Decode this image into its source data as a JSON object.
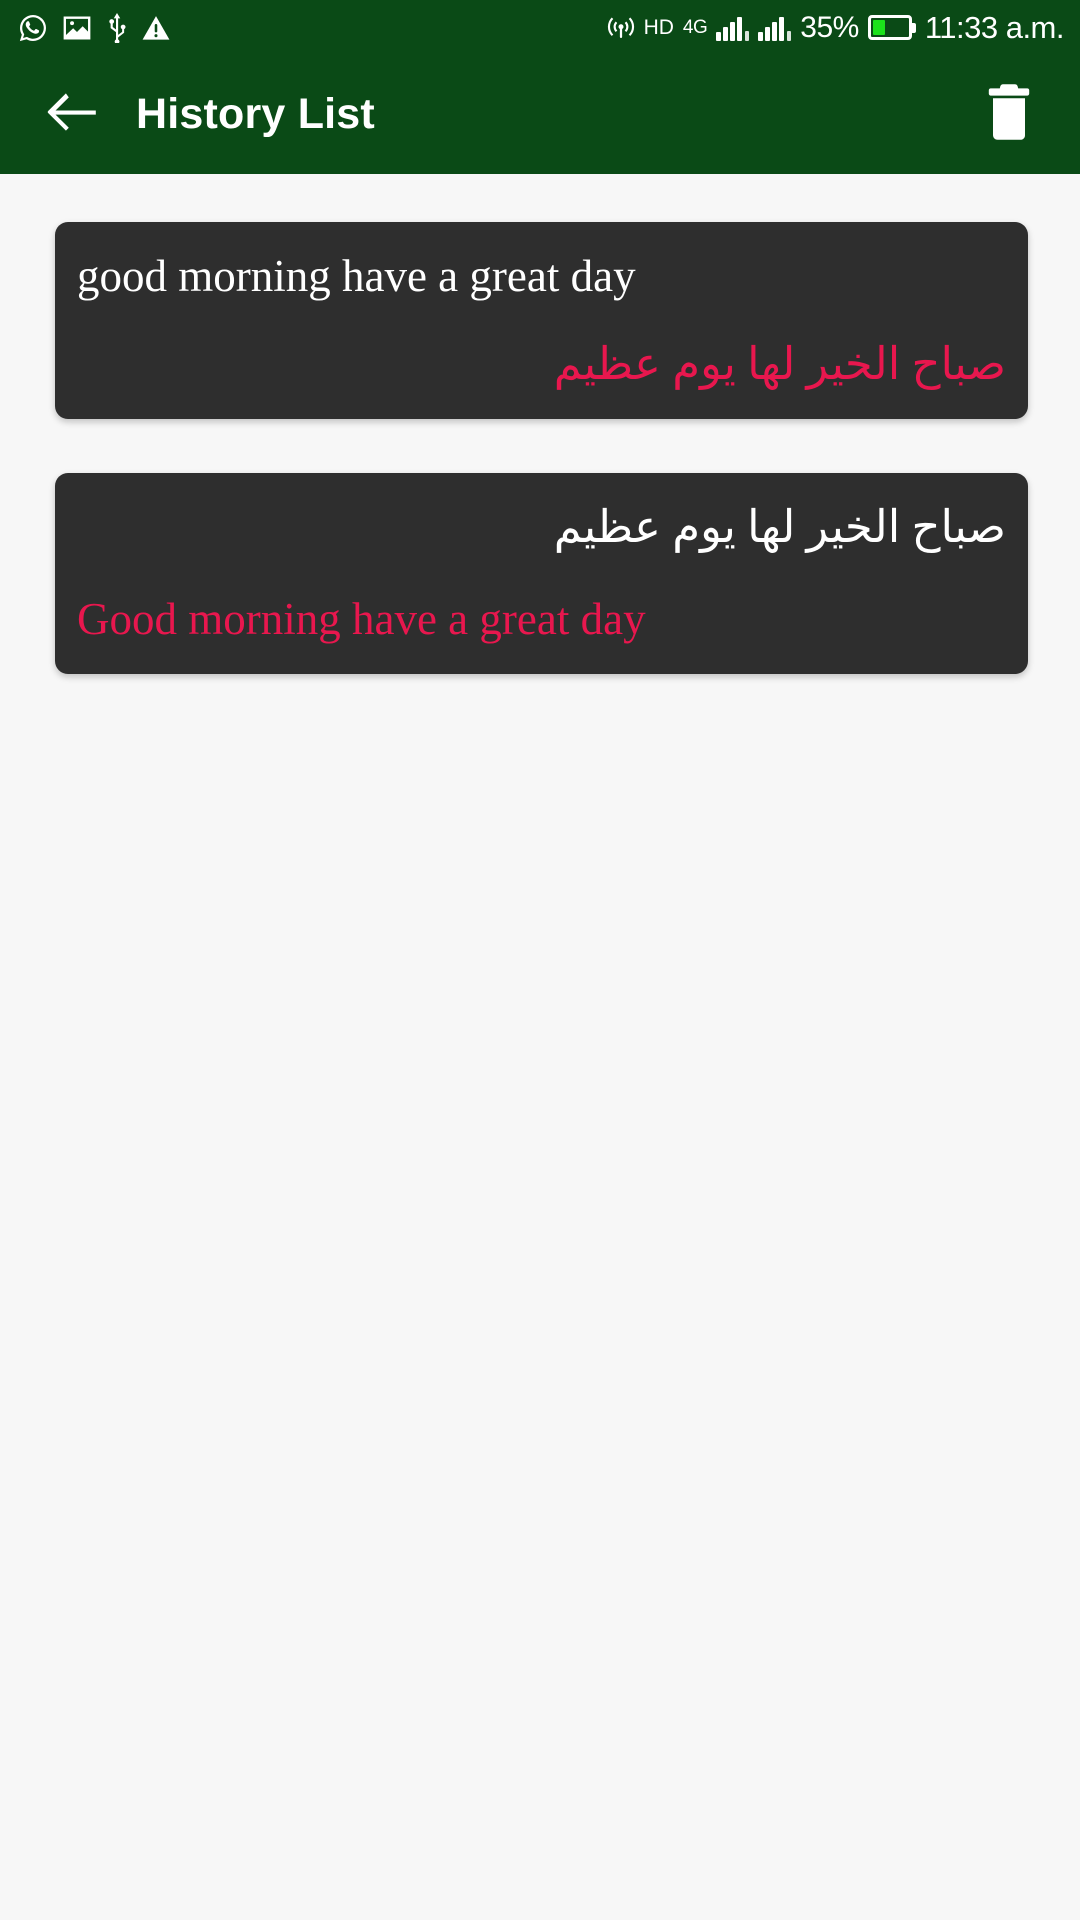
{
  "status_bar": {
    "left_icons": [
      {
        "name": "whatsapp-icon",
        "label": "WhatsApp"
      },
      {
        "name": "image-icon",
        "label": "Screenshot saved"
      },
      {
        "name": "usb-icon",
        "label": "USB connected"
      },
      {
        "name": "warning-icon",
        "label": "Warning"
      }
    ],
    "right": {
      "hotspot_icon": "hotspot-icon",
      "hd_label": "HD",
      "network_label": "4G",
      "battery_percent": "35%",
      "battery_level": 35,
      "clock": "11:33 a.m."
    }
  },
  "app_bar": {
    "back_icon": "back-arrow-icon",
    "title": "History List",
    "delete_icon": "trash-icon"
  },
  "colors": {
    "app_bar_green": "#0A4A16",
    "card_background": "#2E2E2E",
    "page_background": "#F7F7F7",
    "source_text": "#FFFFFF",
    "translation_text": "#E8174E",
    "battery_fill": "#1BE21B"
  },
  "history": {
    "items": [
      {
        "source_text": "good morning have a great day",
        "source_dir": "ltr",
        "translation_text": "صباح الخير لها يوم عظيم",
        "translation_dir": "rtl"
      },
      {
        "source_text": "صباح الخير لها يوم عظيم",
        "source_dir": "rtl",
        "translation_text": "Good morning have a great day",
        "translation_dir": "ltr"
      }
    ]
  }
}
